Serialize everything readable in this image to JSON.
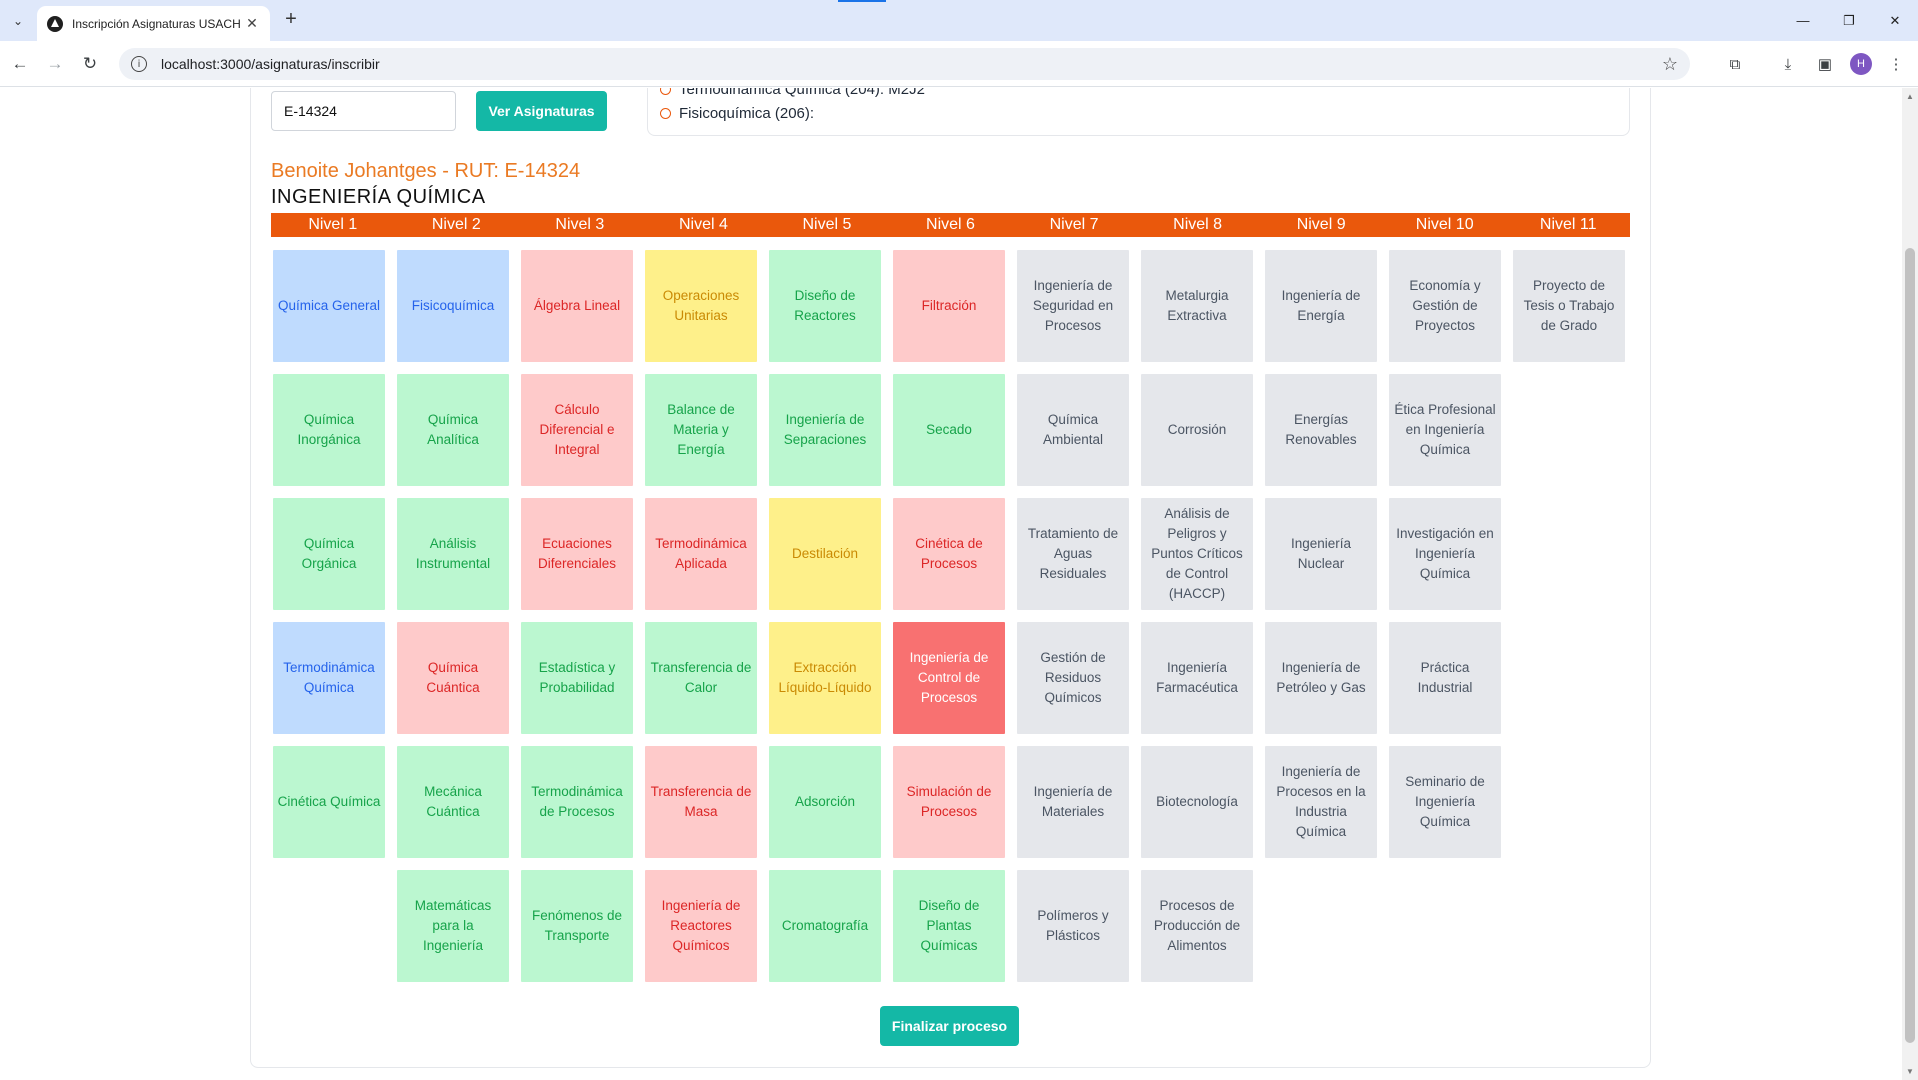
{
  "browser": {
    "tab_title": "Inscripción Asignaturas USACH",
    "url": "localhost:3000/asignaturas/inscribir",
    "profile_initial": "H"
  },
  "form": {
    "rut_value": "E-14324",
    "view_button": "Ver Asignaturas"
  },
  "summary": [
    "Termodinámica Química (204): M2J2",
    "Fisicoquímica (206):"
  ],
  "student": {
    "name": "Benoite Johantges - RUT: E-14324",
    "career": "INGENIERÍA QUÍMICA"
  },
  "levels": [
    "Nivel 1",
    "Nivel 2",
    "Nivel 3",
    "Nivel 4",
    "Nivel 5",
    "Nivel 6",
    "Nivel 7",
    "Nivel 8",
    "Nivel 9",
    "Nivel 10",
    "Nivel 11"
  ],
  "colors": {
    "accent": "#ea580c",
    "teal_button": "#14b8a6",
    "blue_status": "#bfdbfe",
    "green_status": "#bbf7d0",
    "red_status": "#fecaca",
    "yellow_status": "#fef08a",
    "gray_status": "#e5e7eb",
    "selected_status": "#f87171"
  },
  "courses": [
    [
      {
        "name": "Química General",
        "status": "blue"
      },
      {
        "name": "Química Inorgánica",
        "status": "green"
      },
      {
        "name": "Química Orgánica",
        "status": "green"
      },
      {
        "name": "Termodinámica Química",
        "status": "blue"
      },
      {
        "name": "Cinética Química",
        "status": "green"
      }
    ],
    [
      {
        "name": "Fisicoquímica",
        "status": "blue"
      },
      {
        "name": "Química Analítica",
        "status": "green"
      },
      {
        "name": "Análisis Instrumental",
        "status": "green"
      },
      {
        "name": "Química Cuántica",
        "status": "red"
      },
      {
        "name": "Mecánica Cuántica",
        "status": "green"
      },
      {
        "name": "Matemáticas para la Ingeniería",
        "status": "green"
      }
    ],
    [
      {
        "name": "Álgebra Lineal",
        "status": "red"
      },
      {
        "name": "Cálculo Diferencial e Integral",
        "status": "red"
      },
      {
        "name": "Ecuaciones Diferenciales",
        "status": "red"
      },
      {
        "name": "Estadística y Probabilidad",
        "status": "green"
      },
      {
        "name": "Termodinámica de Procesos",
        "status": "green"
      },
      {
        "name": "Fenómenos de Transporte",
        "status": "green"
      }
    ],
    [
      {
        "name": "Operaciones Unitarias",
        "status": "yellow"
      },
      {
        "name": "Balance de Materia y Energía",
        "status": "green"
      },
      {
        "name": "Termodinámica Aplicada",
        "status": "red"
      },
      {
        "name": "Transferencia de Calor",
        "status": "green"
      },
      {
        "name": "Transferencia de Masa",
        "status": "red"
      },
      {
        "name": "Ingeniería de Reactores Químicos",
        "status": "red"
      }
    ],
    [
      {
        "name": "Diseño de Reactores",
        "status": "green"
      },
      {
        "name": "Ingeniería de Separaciones",
        "status": "green"
      },
      {
        "name": "Destilación",
        "status": "yellow"
      },
      {
        "name": "Extracción Líquido-Líquido",
        "status": "yellow"
      },
      {
        "name": "Adsorción",
        "status": "green"
      },
      {
        "name": "Cromatografía",
        "status": "green"
      }
    ],
    [
      {
        "name": "Filtración",
        "status": "red"
      },
      {
        "name": "Secado",
        "status": "green"
      },
      {
        "name": "Cinética de Procesos",
        "status": "red"
      },
      {
        "name": "Ingeniería de Control de Procesos",
        "status": "selected"
      },
      {
        "name": "Simulación de Procesos",
        "status": "red"
      },
      {
        "name": "Diseño de Plantas Químicas",
        "status": "green"
      }
    ],
    [
      {
        "name": "Ingeniería de Seguridad en Procesos",
        "status": "gray"
      },
      {
        "name": "Química Ambiental",
        "status": "gray"
      },
      {
        "name": "Tratamiento de Aguas Residuales",
        "status": "gray"
      },
      {
        "name": "Gestión de Residuos Químicos",
        "status": "gray"
      },
      {
        "name": "Ingeniería de Materiales",
        "status": "gray"
      },
      {
        "name": "Polímeros y Plásticos",
        "status": "gray"
      }
    ],
    [
      {
        "name": "Metalurgia Extractiva",
        "status": "gray"
      },
      {
        "name": "Corrosión",
        "status": "gray"
      },
      {
        "name": "Análisis de Peligros y Puntos Críticos de Control (HACCP)",
        "status": "gray"
      },
      {
        "name": "Ingeniería Farmacéutica",
        "status": "gray"
      },
      {
        "name": "Biotecnología",
        "status": "gray"
      },
      {
        "name": "Procesos de Producción de Alimentos",
        "status": "gray"
      }
    ],
    [
      {
        "name": "Ingeniería de Energía",
        "status": "gray"
      },
      {
        "name": "Energías Renovables",
        "status": "gray"
      },
      {
        "name": "Ingeniería Nuclear",
        "status": "gray"
      },
      {
        "name": "Ingeniería de Petróleo y Gas",
        "status": "gray"
      },
      {
        "name": "Ingeniería de Procesos en la Industria Química",
        "status": "gray"
      }
    ],
    [
      {
        "name": "Economía y Gestión de Proyectos",
        "status": "gray"
      },
      {
        "name": "Ética Profesional en Ingeniería Química",
        "status": "gray"
      },
      {
        "name": "Investigación en Ingeniería Química",
        "status": "gray"
      },
      {
        "name": "Práctica Industrial",
        "status": "gray"
      },
      {
        "name": "Seminario de Ingeniería Química",
        "status": "gray"
      }
    ],
    [
      {
        "name": "Proyecto de Tesis o Trabajo de Grado",
        "status": "gray"
      }
    ]
  ],
  "finish_button": "Finalizar proceso"
}
